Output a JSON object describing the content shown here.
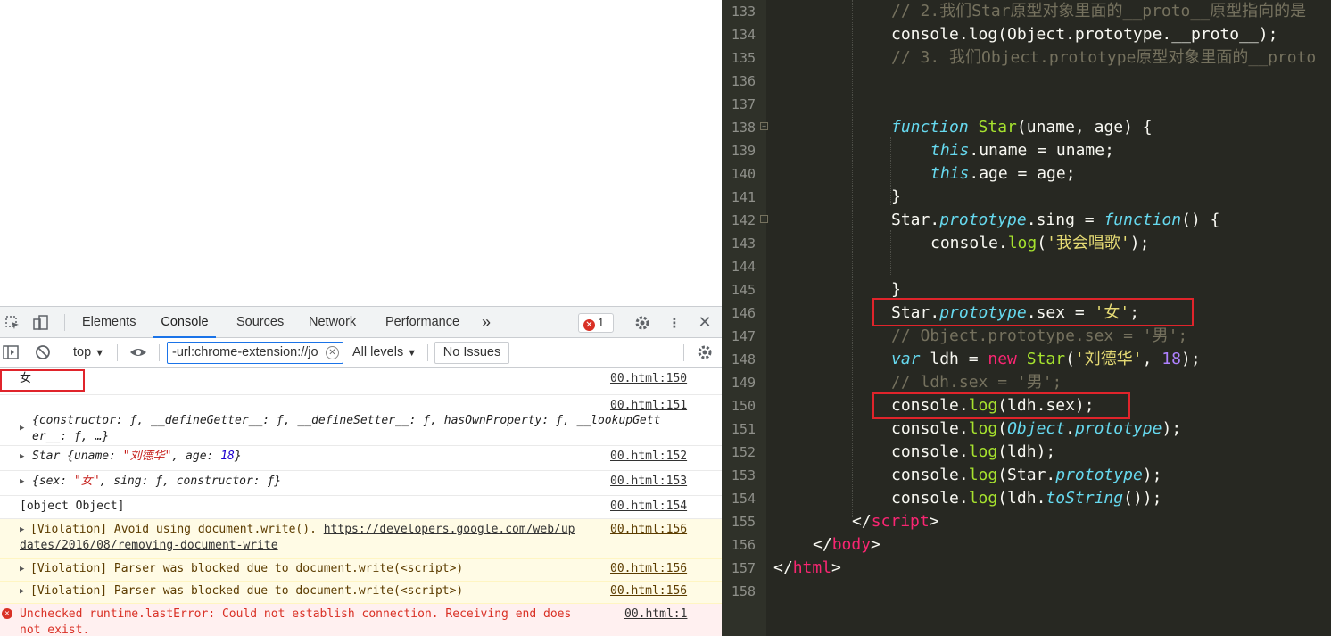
{
  "devtools": {
    "tabs": [
      "Elements",
      "Console",
      "Sources",
      "Network",
      "Performance"
    ],
    "active_tab": "Console",
    "more_tabs_glyph": "»",
    "error_count": "1",
    "toolbar": {
      "context": "top",
      "filter_value": "-url:chrome-extension://jo",
      "levels": "All levels",
      "issues": "No Issues"
    },
    "console": {
      "rows": [
        {
          "text": "女",
          "source": "00.html:150"
        },
        {
          "source": "00.html:151",
          "line1": "{constructor: ƒ, __defineGetter__: ƒ, __defineSetter__: ƒ, hasOwnProperty: ƒ, __lookupGett",
          "line2": "er__: ƒ, …}"
        },
        {
          "source": "00.html:152",
          "prefix": "Star {uname: ",
          "str": "\"刘德华\"",
          "mid": ", age: ",
          "num": "18",
          "suffix": "}"
        },
        {
          "source": "00.html:153",
          "prefix": "{sex: ",
          "str": "\"女\"",
          "suffix": ", sing: ƒ, constructor: ƒ}"
        },
        {
          "text": "[object Object]",
          "source": "00.html:154"
        },
        {
          "source": "00.html:156",
          "prefix": "[Violation] Avoid using document.write(). ",
          "link": "https://developers.google.com/web/up",
          "line2": "dates/2016/08/removing-document-write"
        },
        {
          "text": "[Violation] Parser was blocked due to document.write(<script>)",
          "source": "00.html:156"
        },
        {
          "text": "[Violation] Parser was blocked due to document.write(<script>)",
          "source": "00.html:156"
        },
        {
          "line1": "Unchecked runtime.lastError: Could not establish connection. Receiving end does",
          "line2": "not exist.",
          "source": "00.html:1"
        }
      ]
    }
  },
  "editor": {
    "line_numbers": [
      "133",
      "134",
      "135",
      "136",
      "137",
      "138",
      "139",
      "140",
      "141",
      "142",
      "143",
      "144",
      "145",
      "146",
      "147",
      "148",
      "149",
      "150",
      "151",
      "152",
      "153",
      "154",
      "155",
      "156",
      "157",
      "158"
    ],
    "lines": {
      "l133": "// 2.我们Star原型对象里面的__proto__原型指向的是",
      "l134": "console.log(Object.prototype.__proto__);",
      "l135": "// 3. 我们Object.prototype原型对象里面的__proto",
      "l138_kw": "function",
      "l138_fn": "Star",
      "l138_rest": "(uname, age) {",
      "l139_kw": "this",
      "l139_rest": ".uname = uname;",
      "l140_kw": "this",
      "l140_rest": ".age = age;",
      "l141": "}",
      "l142_a": "Star.",
      "l142_b": "prototype",
      "l142_c": ".sing = ",
      "l142_d": "function",
      "l142_e": "() {",
      "l143_a": "console.",
      "l143_b": "log",
      "l143_c": "(",
      "l143_str": "'我会唱歌'",
      "l143_d": ");",
      "l145": "}",
      "l146_a": "Star.",
      "l146_b": "prototype",
      "l146_c": ".sex = ",
      "l146_str": "'女'",
      "l146_d": ";",
      "l147": "// Object.prototype.sex = '男';",
      "l148_kw": "var",
      "l148_a": " ldh = ",
      "l148_new": "new",
      "l148_fn": " Star",
      "l148_b": "(",
      "l148_str": "'刘德华'",
      "l148_c": ", ",
      "l148_num": "18",
      "l148_d": ");",
      "l149": "// ldh.sex = '男';",
      "l150_a": "console.",
      "l150_b": "log",
      "l150_c": "(ldh.sex);",
      "l151_a": "console.",
      "l151_b": "log",
      "l151_c": "(",
      "l151_d": "Object",
      "l151_e": ".",
      "l151_f": "prototype",
      "l151_g": ");",
      "l152_a": "console.",
      "l152_b": "log",
      "l152_c": "(ldh);",
      "l153_a": "console.",
      "l153_b": "log",
      "l153_c": "(Star.",
      "l153_d": "prototype",
      "l153_e": ");",
      "l154_a": "console.",
      "l154_b": "log",
      "l154_c": "(ldh.",
      "l154_d": "toString",
      "l154_e": "());",
      "l155_a": "</",
      "l155_b": "script",
      "l155_c": ">",
      "l156_a": "</",
      "l156_b": "body",
      "l156_c": ">",
      "l157_a": "</",
      "l157_b": "html",
      "l157_c": ">"
    }
  }
}
